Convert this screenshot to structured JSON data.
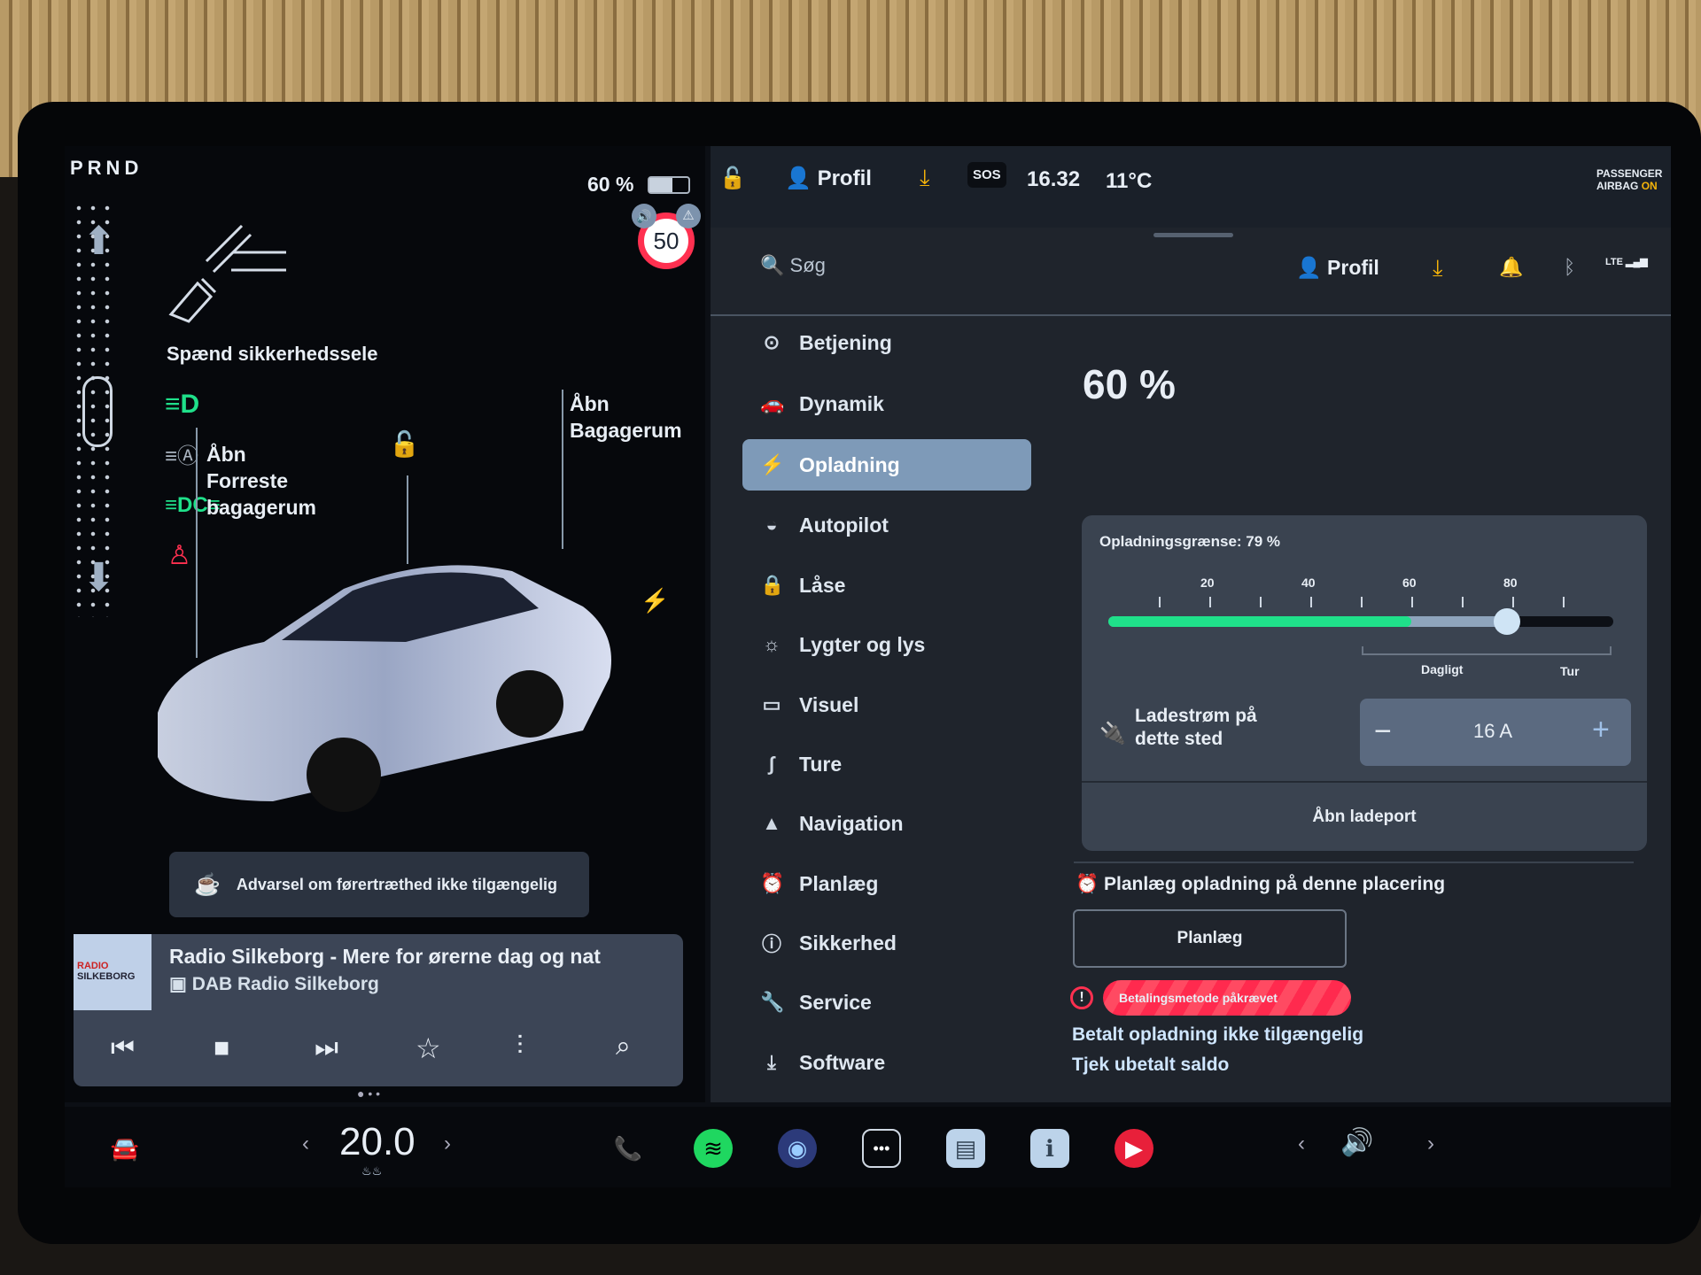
{
  "gear": "PRND",
  "battery": {
    "percent_label": "60 %",
    "level": 60
  },
  "speed_limit": "50",
  "alerts": {
    "seatbelt": "Spænd sikkerhedssele",
    "frunk": "Åbn\nForreste\nbagagerum",
    "trunk": "Åbn\nBagagerum",
    "fatigue": "Advarsel om førertræthed ikke tilgængelig"
  },
  "media": {
    "title": "Radio Silkeborg - Mere for ørerne dag og nat",
    "source": "DAB Radio Silkeborg",
    "logo": "RADIO SILKEBORG"
  },
  "climate": {
    "temp": "20.0"
  },
  "status": {
    "profile": "Profil",
    "time": "16.32",
    "temp": "11°C",
    "sos": "SOS",
    "airbag_line1": "PASSENGER",
    "airbag_line2": "AIRBAG",
    "airbag_state": "ON"
  },
  "search": {
    "placeholder": "Søg"
  },
  "header": {
    "profile": "Profil",
    "lte": "LTE"
  },
  "menu": [
    {
      "label": "Betjening",
      "icon": "toggle-icon"
    },
    {
      "label": "Dynamik",
      "icon": "car-icon"
    },
    {
      "label": "Opladning",
      "icon": "bolt-icon",
      "active": true
    },
    {
      "label": "Autopilot",
      "icon": "steering-wheel-icon"
    },
    {
      "label": "Låse",
      "icon": "lock-icon"
    },
    {
      "label": "Lygter og lys",
      "icon": "sun-icon"
    },
    {
      "label": "Visuel",
      "icon": "display-icon"
    },
    {
      "label": "Ture",
      "icon": "trips-icon"
    },
    {
      "label": "Navigation",
      "icon": "navigation-icon"
    },
    {
      "label": "Planlæg",
      "icon": "alarm-icon"
    },
    {
      "label": "Sikkerhed",
      "icon": "alert-icon"
    },
    {
      "label": "Service",
      "icon": "wrench-icon"
    },
    {
      "label": "Software",
      "icon": "download-icon"
    }
  ],
  "charging": {
    "title": "60 %",
    "limit_label": "Opladningsgrænse: 79 %",
    "limit": 79,
    "current_charge": 60,
    "ticks": [
      "20",
      "40",
      "60",
      "80"
    ],
    "daily": "Dagligt",
    "trip": "Tur",
    "current_label_1": "Ladestrøm på",
    "current_label_2": "dette sted",
    "amps": "16 A",
    "open_port": "Åbn ladeport",
    "schedule_heading": "Planlæg opladning på denne placering",
    "schedule_button": "Planlæg",
    "payment_badge": "Betalingsmetode påkrævet",
    "paid_unavailable": "Betalt opladning ikke tilgængelig",
    "check_balance": "Tjek ubetalt saldo"
  },
  "colors": {
    "accent_green": "#1fe08a",
    "alert_red": "#ff3050",
    "active_menu": "#7e9ab8",
    "warning_yellow": "#f5b40a"
  }
}
